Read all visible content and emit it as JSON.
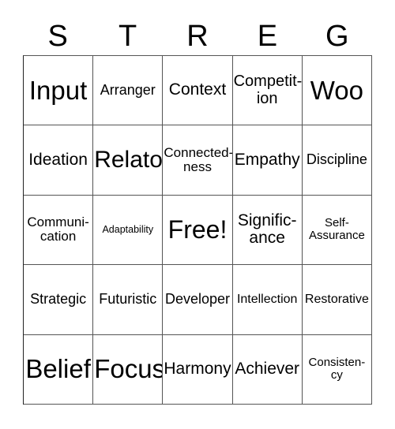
{
  "card": {
    "header_letters": [
      "S",
      "T",
      "R",
      "E",
      "G"
    ],
    "colors": {
      "background": "#ffffff",
      "text": "#000000",
      "grid_line": "#555555"
    },
    "rows": [
      [
        {
          "label": "Input",
          "display": "Input"
        },
        {
          "label": "Arranger",
          "display": "Arranger"
        },
        {
          "label": "Context",
          "display": "Context"
        },
        {
          "label": "Competition",
          "display": "Competit-\nion"
        },
        {
          "label": "Woo",
          "display": "Woo"
        }
      ],
      [
        {
          "label": "Ideation",
          "display": "Ideation"
        },
        {
          "label": "Relator",
          "display": "Relator"
        },
        {
          "label": "Connectedness",
          "display": "Connected-\nness"
        },
        {
          "label": "Empathy",
          "display": "Empathy"
        },
        {
          "label": "Discipline",
          "display": "Discipline"
        }
      ],
      [
        {
          "label": "Communication",
          "display": "Communi-\ncation"
        },
        {
          "label": "Adaptability",
          "display": "Adaptability"
        },
        {
          "label": "Free!",
          "display": "Free!"
        },
        {
          "label": "Significance",
          "display": "Signific-\nance"
        },
        {
          "label": "Self-Assurance",
          "display": "Self-\nAssurance"
        }
      ],
      [
        {
          "label": "Strategic",
          "display": "Strategic"
        },
        {
          "label": "Futuristic",
          "display": "Futuristic"
        },
        {
          "label": "Developer",
          "display": "Developer"
        },
        {
          "label": "Intellection",
          "display": "Intellection"
        },
        {
          "label": "Restorative",
          "display": "Restorative"
        }
      ],
      [
        {
          "label": "Belief",
          "display": "Belief"
        },
        {
          "label": "Focus",
          "display": "Focus"
        },
        {
          "label": "Harmony",
          "display": "Harmony"
        },
        {
          "label": "Achiever",
          "display": "Achiever"
        },
        {
          "label": "Consistency",
          "display": "Consisten-\ncy"
        }
      ]
    ]
  }
}
